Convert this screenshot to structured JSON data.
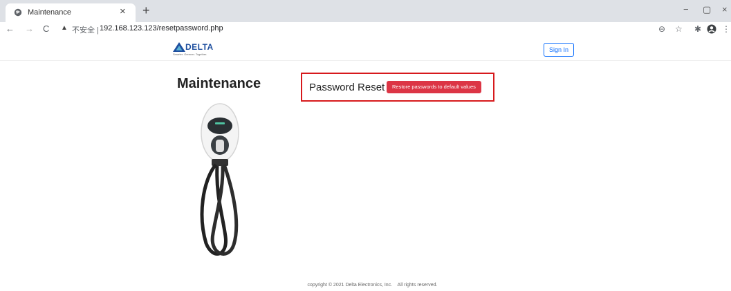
{
  "browser": {
    "tab_title": "Maintenance",
    "tab_close": "×",
    "new_tab": "+",
    "back": "←",
    "forward": "→",
    "reload": "C",
    "insecure_label": "不安全 |",
    "url": "192.168.123.123/resetpassword.php",
    "zoom_icon": "⊖",
    "star_icon": "☆",
    "extensions_icon": "✱",
    "menu_icon": "⋮",
    "minimize": "−",
    "maximize": "▢",
    "close": "×"
  },
  "navbar": {
    "logo_text": "DELTA",
    "logo_tagline": "Smarter. Greener. Together.",
    "signin_label": "Sign In",
    "brand_color": "#1d4e9e",
    "signin_color": "#0d6efd"
  },
  "main": {
    "title": "Maintenance",
    "reset_label": "Password Reset",
    "restore_button": "Restore passwords to default values",
    "restore_color": "#dc3545",
    "highlight_color": "#d7191c"
  },
  "footer": {
    "text": "copyright © 2021 Delta Electronics, Inc.    All rights reserved."
  }
}
